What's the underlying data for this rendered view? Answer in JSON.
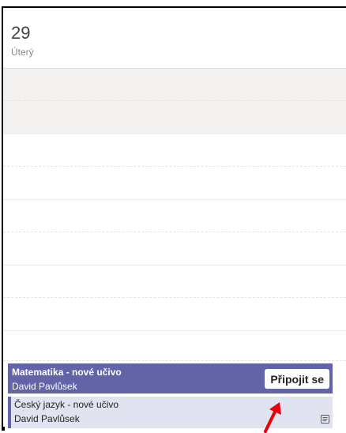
{
  "day": {
    "number": "29",
    "name": "Úterý"
  },
  "events": {
    "math": {
      "title": "Matematika - nové učivo",
      "organizer": "David Pavlůsek",
      "join_label": "Připojit se",
      "color": "#6264a7"
    },
    "czech": {
      "title": "Český jazyk - nové učivo",
      "organizer": "David Pavlůsek",
      "icon": "notes-icon",
      "color": "#e2e3f1"
    }
  },
  "annotation": {
    "arrow_color": "#e8000b"
  }
}
